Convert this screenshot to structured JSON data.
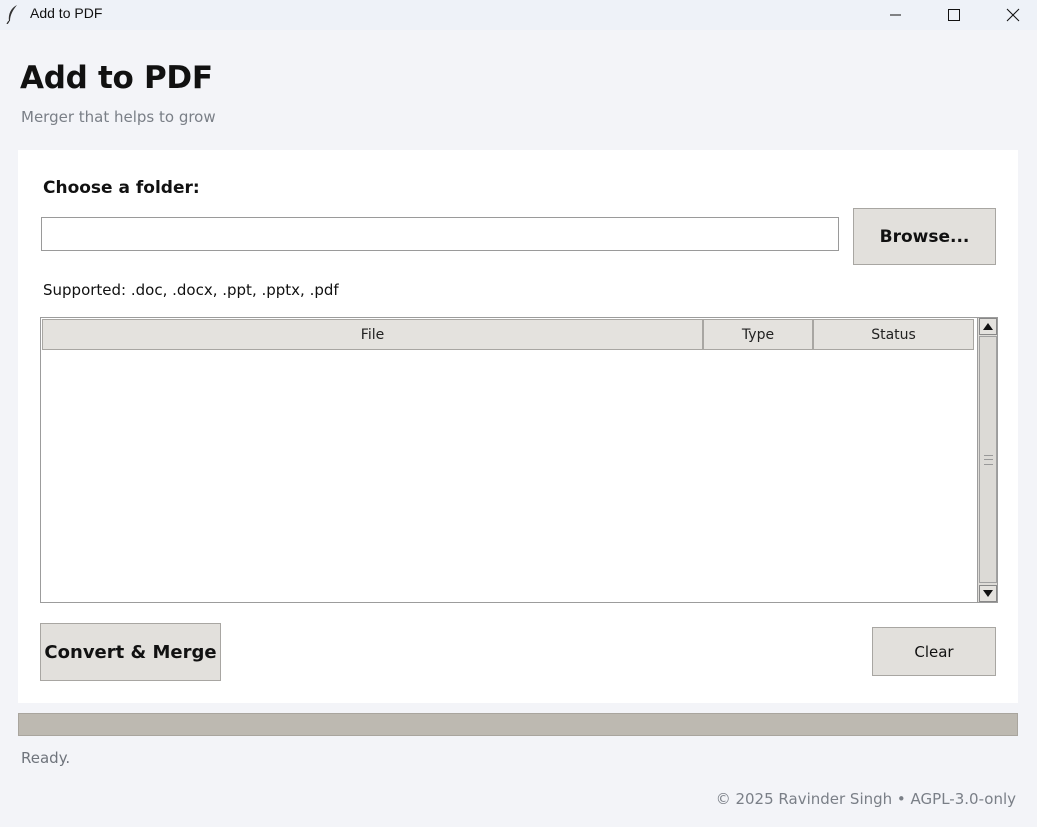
{
  "window": {
    "title": "Add to PDF",
    "icon": "feather-icon",
    "controls": [
      "minimize-icon",
      "maximize-icon",
      "close-icon"
    ]
  },
  "header": {
    "title": "Add to PDF",
    "subtitle": "Merger that helps to grow"
  },
  "folder": {
    "label": "Choose a folder:",
    "value": "",
    "placeholder": "",
    "browse_label": "Browse..."
  },
  "supported_text": "Supported: .doc, .docx, .ppt, .pptx, .pdf",
  "table": {
    "columns": [
      "File",
      "Type",
      "Status"
    ],
    "rows": []
  },
  "actions": {
    "convert_label": "Convert & Merge",
    "clear_label": "Clear"
  },
  "progress": {
    "value": 0
  },
  "status_text": "Ready.",
  "footer_text": "© 2025 Ravinder Singh • AGPL-3.0-only",
  "colors": {
    "background": "#f3f4f8",
    "card": "#ffffff",
    "button": "#e2e0dc",
    "progress_track": "#bdb9b1",
    "muted_text": "#7a7f87"
  }
}
